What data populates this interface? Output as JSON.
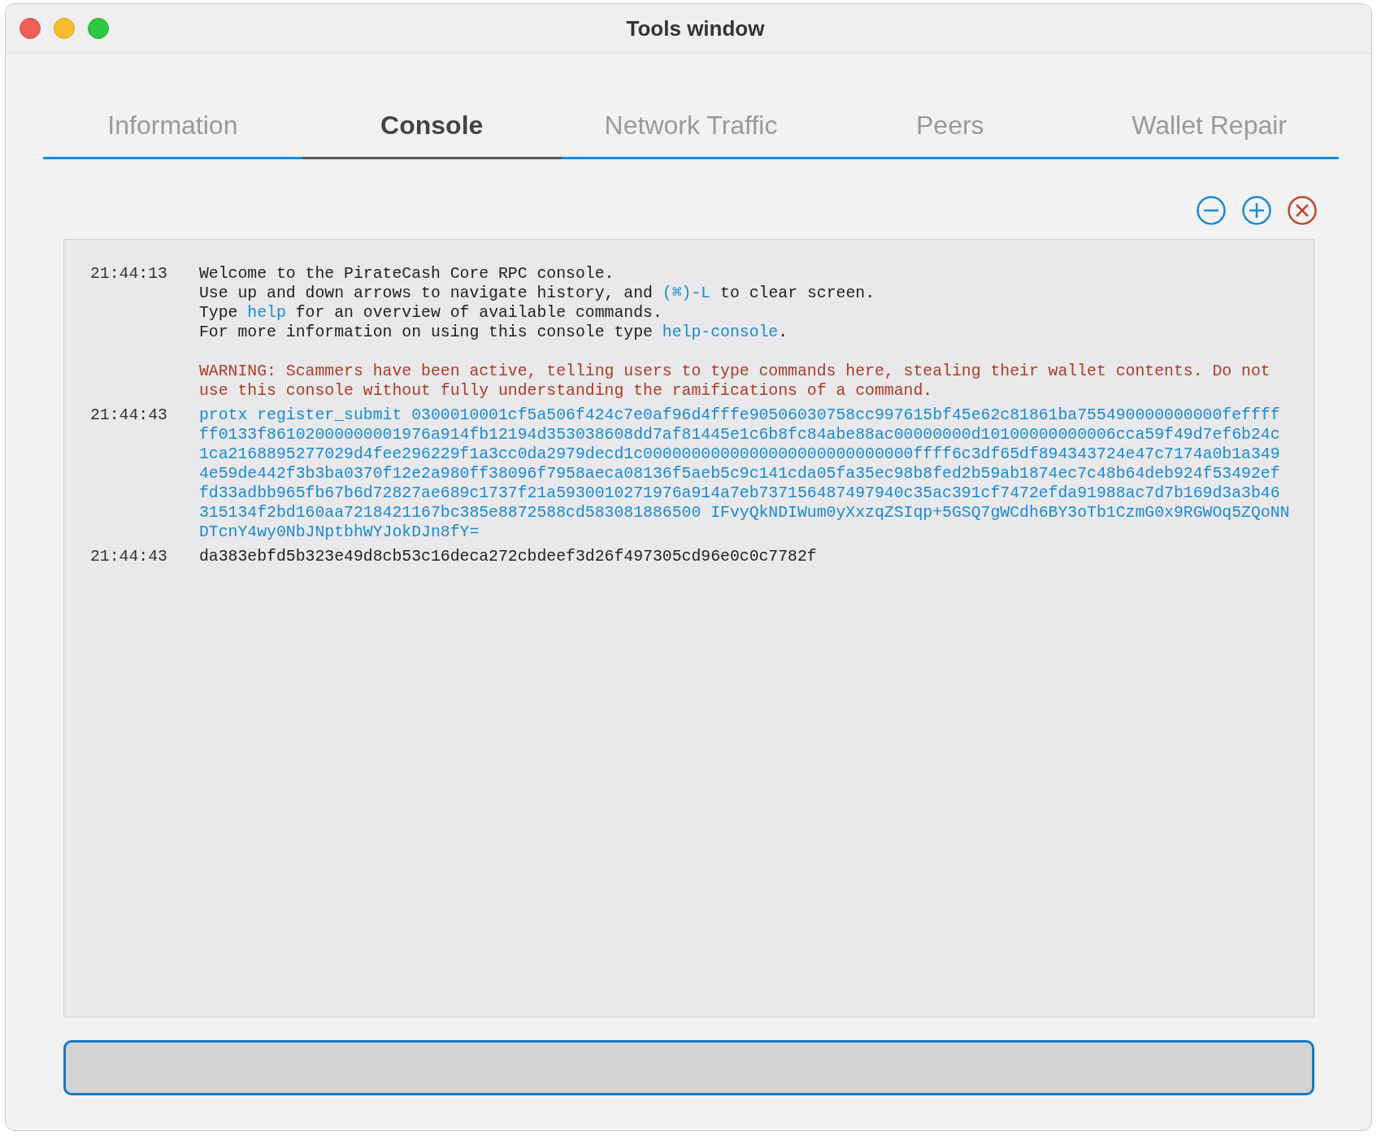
{
  "window": {
    "title": "Tools window"
  },
  "tabs": [
    {
      "label": "Information",
      "selected": false
    },
    {
      "label": "Console",
      "selected": true
    },
    {
      "label": "Network Traffic",
      "selected": false
    },
    {
      "label": "Peers",
      "selected": false
    },
    {
      "label": "Wallet Repair",
      "selected": false
    }
  ],
  "toolbar": [
    {
      "kind": "zoom-out"
    },
    {
      "kind": "zoom-in"
    },
    {
      "kind": "clear"
    }
  ],
  "console": {
    "entries": [
      {
        "time": "21:44:13",
        "paragraphs": [
          [
            [
              {
                "text": "Welcome to the PirateCash Core RPC console.",
                "kind": "plain"
              }
            ],
            [
              {
                "text": "Use up and down arrows to navigate history, and ",
                "kind": "plain"
              },
              {
                "text": "(⌘)-L",
                "kind": "command"
              },
              {
                "text": " to clear screen.",
                "kind": "plain"
              }
            ],
            [
              {
                "text": "Type ",
                "kind": "plain"
              },
              {
                "text": "help",
                "kind": "command"
              },
              {
                "text": " for an overview of available commands.",
                "kind": "plain"
              }
            ],
            [
              {
                "text": "For more information on using this console type ",
                "kind": "plain"
              },
              {
                "text": "help-console",
                "kind": "command"
              },
              {
                "text": ".",
                "kind": "plain"
              }
            ]
          ],
          [
            [
              {
                "text": "WARNING: Scammers have been active, telling users to type commands here, stealing their wallet contents. Do not",
                "kind": "warning"
              }
            ],
            [
              {
                "text": "use this console without fully understanding the ramifications of a command.",
                "kind": "warning"
              }
            ]
          ]
        ]
      },
      {
        "time": "21:44:43",
        "paragraphs": [
          [
            [
              {
                "text": "protx register_submit 0300010001cf5a506f424c7e0af96d4fffe90506030758cc997615bf45e62c81861ba755490000000000feffff",
                "kind": "command"
              }
            ],
            [
              {
                "text": "ff0133f86102000000001976a914fb12194d353038608dd7af81445e1c6b8fc84abe88ac00000000d10100000000006cca59f49d7ef6b24c",
                "kind": "command"
              }
            ],
            [
              {
                "text": "1ca2168895277029d4fee296229f1a3cc0da2979decd1c0000000000000000000000000000ffff6c3df65df894343724e47c7174a0b1a349",
                "kind": "command"
              }
            ],
            [
              {
                "text": "4e59de442f3b3ba0370f12e2a980ff38096f7958aeca08136f5aeb5c9c141cda05fa35ec98b8fed2b59ab1874ec7c48b64deb924f53492ef",
                "kind": "command"
              }
            ],
            [
              {
                "text": "fd33adbb965fb67b6d72827ae689c1737f21a5930010271976a914a7eb737156487497940c35ac391cf7472efda91988ac7d7b169d3a3b46",
                "kind": "command"
              }
            ],
            [
              {
                "text": "315134f2bd160aa7218421167bc385e8872588cd583081886500 IFvyQkNDIWum0yXxzqZSIqp+5GSQ7gWCdh6BY3oTb1CzmG0x9RGWOq5ZQoNN",
                "kind": "command"
              }
            ],
            [
              {
                "text": "DTcnY4wy0NbJNptbhWYJokDJn8fY=",
                "kind": "command"
              }
            ]
          ]
        ]
      },
      {
        "time": "21:44:43",
        "paragraphs": [
          [
            [
              {
                "text": "da383ebfd5b323e49d8cb53c16deca272cbdeef3d26f497305cd96e0c0c7782f",
                "kind": "plain"
              }
            ]
          ]
        ]
      }
    ]
  }
}
